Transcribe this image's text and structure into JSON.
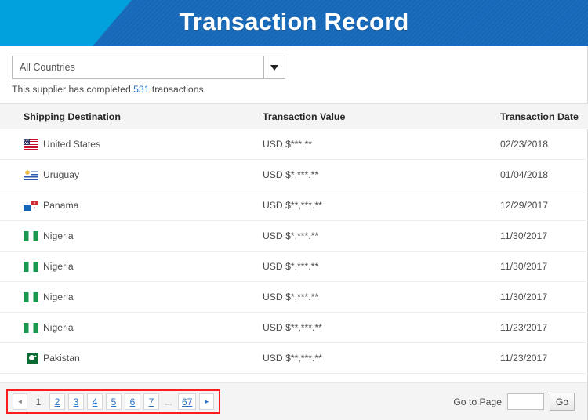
{
  "header": {
    "title": "Transaction Record",
    "accent_light": "#00a1dd",
    "accent_dark": "#1668b8"
  },
  "filter": {
    "country_select_value": "All Countries",
    "country_select_icon": "chevron-down-icon"
  },
  "summary": {
    "prefix": "This supplier has completed ",
    "count": "531",
    "suffix": " transactions."
  },
  "table": {
    "columns": [
      "Shipping Destination",
      "Transaction Value",
      "Transaction Date"
    ],
    "rows": [
      {
        "flag": "us",
        "destination": "United States",
        "value": "USD $***.**",
        "date": "02/23/2018"
      },
      {
        "flag": "uy",
        "destination": "Uruguay",
        "value": "USD $*,***.**",
        "date": "01/04/2018"
      },
      {
        "flag": "pa",
        "destination": "Panama",
        "value": "USD $**,***.**",
        "date": "12/29/2017"
      },
      {
        "flag": "ng",
        "destination": "Nigeria",
        "value": "USD $*,***.**",
        "date": "11/30/2017"
      },
      {
        "flag": "ng",
        "destination": "Nigeria",
        "value": "USD $*,***.**",
        "date": "11/30/2017"
      },
      {
        "flag": "ng",
        "destination": "Nigeria",
        "value": "USD $*,***.**",
        "date": "11/30/2017"
      },
      {
        "flag": "ng",
        "destination": "Nigeria",
        "value": "USD $**,***.**",
        "date": "11/23/2017"
      },
      {
        "flag": "pk",
        "destination": "Pakistan",
        "value": "USD $**,***.**",
        "date": "11/23/2017"
      }
    ]
  },
  "pagination": {
    "prev_label": "◄",
    "next_label": "►",
    "current_page": "1",
    "pages": [
      "2",
      "3",
      "4",
      "5",
      "6",
      "7"
    ],
    "ellipsis": "...",
    "last_page": "67",
    "highlight_color": "#ff1b1b"
  },
  "goto": {
    "label": "Go to Page",
    "input_value": "",
    "button_label": "Go"
  }
}
